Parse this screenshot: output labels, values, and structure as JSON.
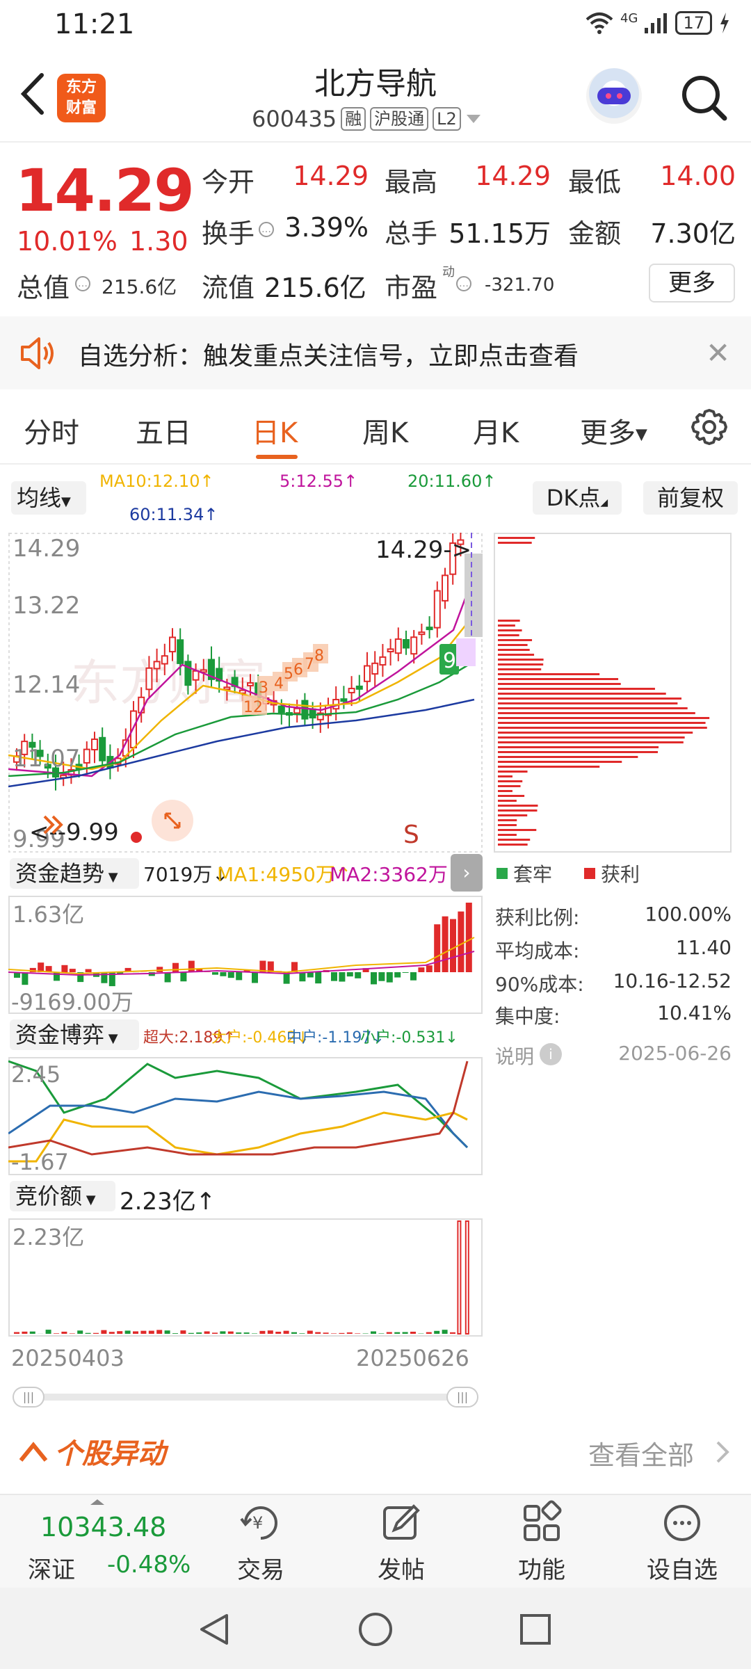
{
  "status": {
    "time": "11:21",
    "network": "4G",
    "battery": "17"
  },
  "header": {
    "logo_line1": "东方",
    "logo_line2": "财富",
    "name": "北方导航",
    "code": "600435",
    "tags": [
      "融",
      "沪股通",
      "L2"
    ]
  },
  "quote": {
    "price": "14.29",
    "pct": "10.01%",
    "chg": "1.30",
    "open_label": "今开",
    "open": "14.29",
    "high_label": "最高",
    "high": "14.29",
    "low_label": "最低",
    "low": "14.00",
    "turnover_label": "换手",
    "turnover": "3.39%",
    "volume_label": "总手",
    "volume": "51.15万",
    "amount_label": "金额",
    "amount": "7.30亿",
    "mcap_label": "总值",
    "mcap": "215.6亿",
    "float_label": "流值",
    "float": "215.6亿",
    "pe_label": "市盈",
    "pe_sup": "动",
    "pe": "-321.70",
    "more": "更多"
  },
  "alert": {
    "text": "自选分析：触发重点关注信号，立即点击查看"
  },
  "tabs": {
    "items": [
      "分时",
      "五日",
      "日K",
      "周K",
      "月K",
      "更多"
    ],
    "active": "日K"
  },
  "kline": {
    "ma_selector": "均线",
    "ma10": "MA10:12.10↑",
    "ma5": "5:12.55↑",
    "ma20": "20:11.60↑",
    "ma60": "60:11.34↑",
    "dk_label": "DK点",
    "fq_label": "前复权",
    "y_top": "14.29",
    "y_2": "13.22",
    "y_3": "12.14",
    "y_4": "11.07",
    "y_low": "9.99",
    "last_marker": "14.29->",
    "low_marker": "<--9.99",
    "s_marker": "S",
    "td_count": "9",
    "watermark": "东方财富"
  },
  "funds_trend": {
    "selector": "资金趋势",
    "value": "7019万↓",
    "ma1": "MA1:4950万↑",
    "ma2": "MA2:3362万↑",
    "y_top": "1.63亿",
    "y_bottom": "-9169.00万"
  },
  "funds_game": {
    "selector": "资金博弈",
    "super": "超大:2.189↑",
    "big": "大户:-0.462↓",
    "mid": "中户:-1.197↓",
    "small": "小户:-0.531↓",
    "y_top": "2.45",
    "y_bottom": "-1.67"
  },
  "auction": {
    "selector": "竞价额",
    "value": "2.23亿↑",
    "y_top": "2.23亿"
  },
  "date_range": {
    "start": "20250403",
    "end": "20250626"
  },
  "chips": {
    "legend_hold": "套牢",
    "legend_profit": "获利",
    "stats": [
      {
        "label": "获利比例:",
        "value": "100.00%"
      },
      {
        "label": "平均成本:",
        "value": "11.40"
      },
      {
        "label": "90%成本:",
        "value": "10.16-12.52"
      },
      {
        "label": "集中度:",
        "value": "10.41%"
      }
    ],
    "note_label": "说明",
    "date": "2025-06-26"
  },
  "anomaly": {
    "title": "个股异动",
    "view_all": "查看全部"
  },
  "bottom_nav": {
    "index_value": "10343.48",
    "index_name": "深证",
    "index_pct": "-0.48%",
    "items": [
      "交易",
      "发帖",
      "功能",
      "设自选"
    ]
  },
  "colors": {
    "up": "#e02a2a",
    "down": "#1a9a3a",
    "accent": "#e8621f",
    "ma5": "#c0149c",
    "ma10": "#f0b400",
    "ma20": "#1a9a3a",
    "ma60": "#1c3aa0"
  }
}
